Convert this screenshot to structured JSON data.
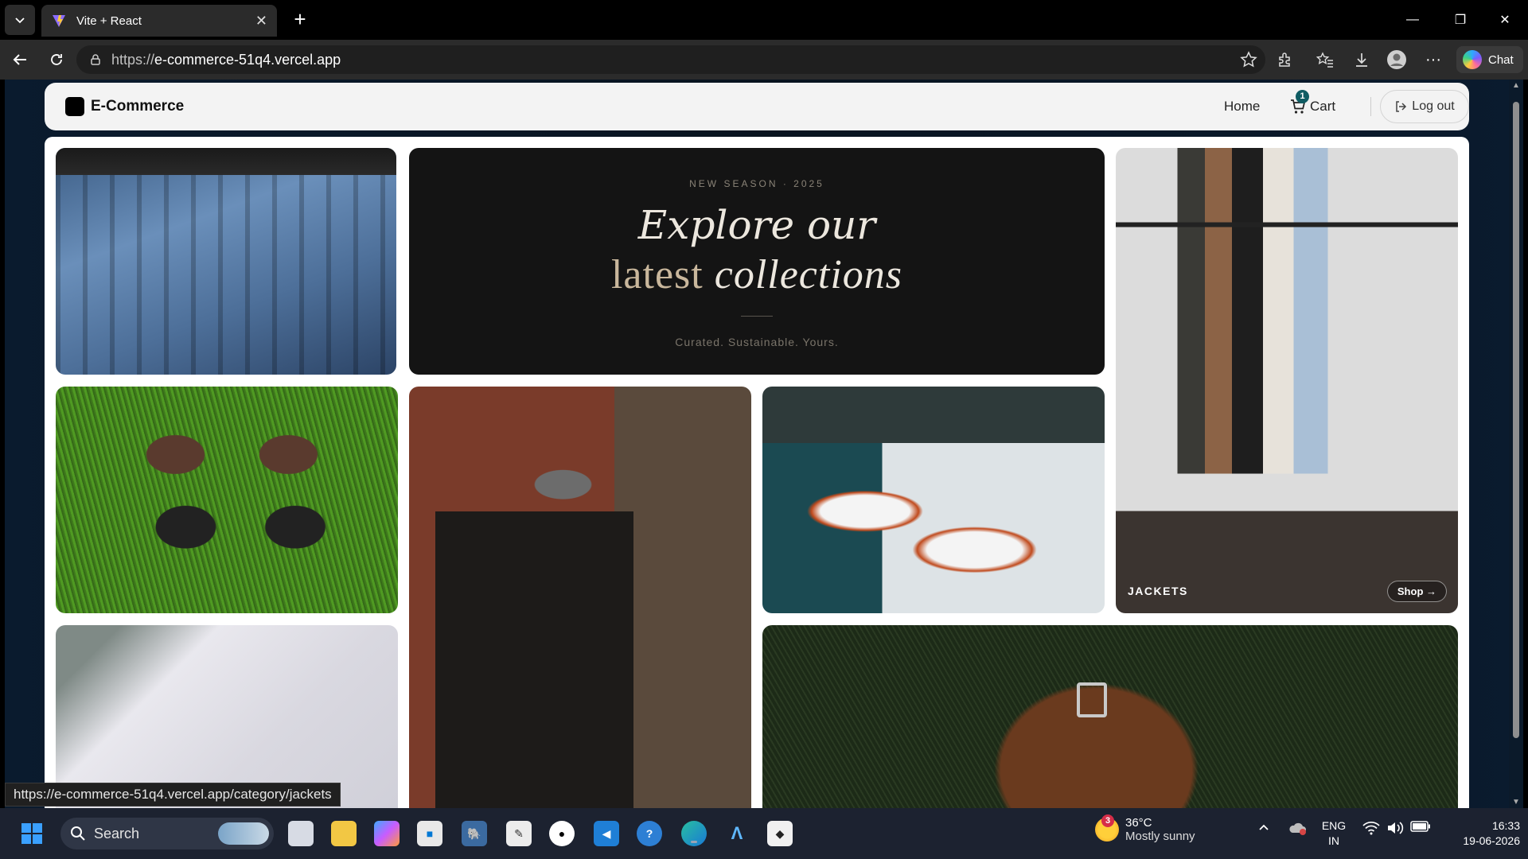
{
  "browser": {
    "tab_title": "Vite + React",
    "url_protocol": "https://",
    "url_host": "e-commerce-51q4.vercel.app",
    "chat_label": "Chat",
    "status_url": "https://e-commerce-51q4.vercel.app/category/jackets"
  },
  "site": {
    "brand": "E-Commerce",
    "nav": {
      "home": "Home",
      "cart": "Cart",
      "cart_count": "1",
      "logout": "Log out"
    }
  },
  "hero": {
    "eyebrow": "NEW SEASON · 2025",
    "line1": "Explore our",
    "line2_a": "latest",
    "line2_b": "collections",
    "tagline": "Curated. Sustainable. Yours."
  },
  "categories": {
    "jackets_label": "JACKETS",
    "shop_label": "Shop →"
  },
  "taskbar": {
    "search": "Search",
    "weather_temp": "36°C",
    "weather_desc": "Mostly sunny",
    "weather_badge": "3",
    "lang_1": "ENG",
    "lang_2": "IN",
    "time": "16:33",
    "date": "19-06-2026"
  },
  "colors": {
    "accent_badge": "#0f5c63",
    "hero_bg": "#141414",
    "taskbar_bg": "#1c2230"
  }
}
